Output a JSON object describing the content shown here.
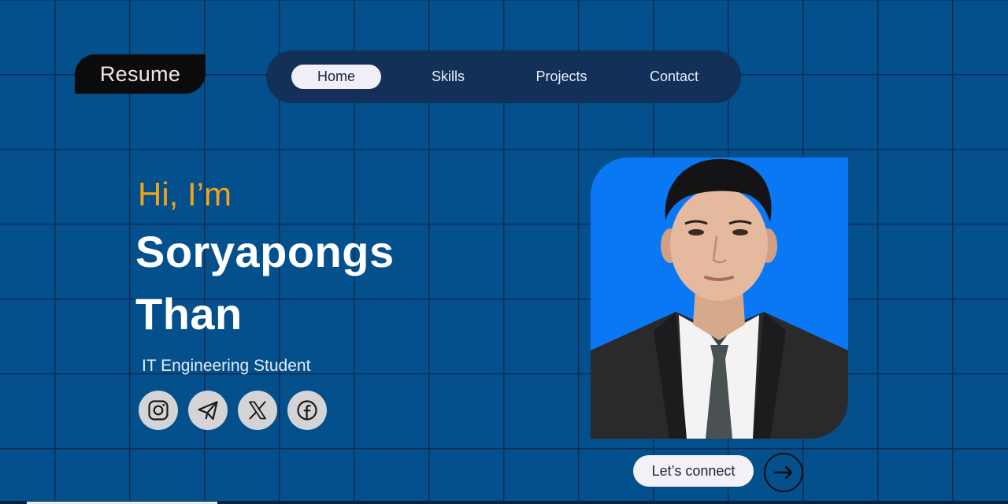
{
  "header": {
    "logo_text": "Resume"
  },
  "nav": {
    "items": [
      {
        "label": "Home",
        "active": true
      },
      {
        "label": "Skills",
        "active": false
      },
      {
        "label": "Projects",
        "active": false
      },
      {
        "label": "Contact",
        "active": false
      }
    ]
  },
  "hero": {
    "greeting": "Hi, I’m",
    "first_name": "Soryapongs",
    "last_name": "Than",
    "role": "IT Engineering Student"
  },
  "social": [
    {
      "icon": "instagram-icon"
    },
    {
      "icon": "telegram-icon"
    },
    {
      "icon": "x-icon"
    },
    {
      "icon": "facebook-icon"
    }
  ],
  "photo": {
    "icon": "profile-photo"
  },
  "cta": {
    "connect_label": "Let’s connect",
    "arrow_icon": "arrow-right-icon"
  },
  "colors": {
    "background": "#03508c",
    "grid_line": "#0b2c54",
    "nav_background": "#133158",
    "accent": "#f2a316",
    "photo_background": "#0a78f5"
  }
}
